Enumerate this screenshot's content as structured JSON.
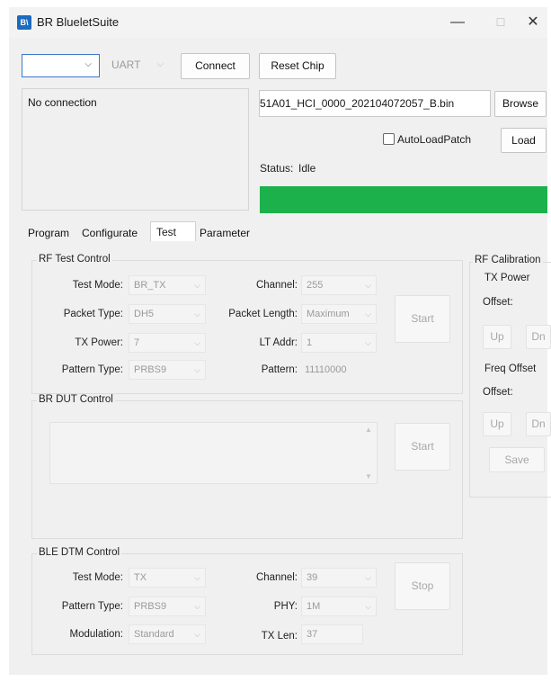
{
  "window": {
    "title": "BR BlueletSuite",
    "icon_text": "B\\",
    "minimize": "—",
    "maximize": "☐",
    "close": "✕"
  },
  "toolbar": {
    "port_value": "",
    "interface_value": "UART",
    "connect_label": "Connect",
    "reset_label": "Reset Chip"
  },
  "connection": {
    "status_text": "No connection"
  },
  "patch": {
    "file_name": "51A01_HCI_0000_202104072057_B.bin",
    "browse_label": "Browse",
    "autoload_label": "AutoLoadPatch",
    "autoload_checked": false,
    "load_label": "Load"
  },
  "status": {
    "label": "Status:",
    "value": "Idle",
    "bar_color": "#1cb14a",
    "progress": 1.0
  },
  "tabs": [
    {
      "label": "Program"
    },
    {
      "label": "Configurate"
    },
    {
      "label": "Test"
    },
    {
      "label": "Parameter"
    }
  ],
  "active_tab": "Test",
  "rf_test": {
    "title": "RF Test Control",
    "test_mode_label": "Test Mode:",
    "test_mode_value": "BR_TX",
    "channel_label": "Channel:",
    "channel_value": "255",
    "packet_type_label": "Packet Type:",
    "packet_type_value": "DH5",
    "packet_length_label": "Packet Length:",
    "packet_length_value": "Maximum",
    "tx_power_label": "TX Power:",
    "tx_power_value": "7",
    "lt_addr_label": "LT Addr:",
    "lt_addr_value": "1",
    "pattern_type_label": "Pattern Type:",
    "pattern_type_value": "PRBS9",
    "pattern_label": "Pattern:",
    "pattern_value": "11110000",
    "start_label": "Start"
  },
  "br_dut": {
    "title": "BR DUT Control",
    "start_label": "Start"
  },
  "ble_dtm": {
    "title": "BLE DTM Control",
    "test_mode_label": "Test Mode:",
    "test_mode_value": "TX",
    "channel_label": "Channel:",
    "channel_value": "39",
    "pattern_type_label": "Pattern Type:",
    "pattern_type_value": "PRBS9",
    "phy_label": "PHY:",
    "phy_value": "1M",
    "modulation_label": "Modulation:",
    "modulation_value": "Standard",
    "tx_len_label": "TX Len:",
    "tx_len_value": "37",
    "stop_label": "Stop"
  },
  "rf_calibration": {
    "title": "RF Calibration",
    "tx_power_title": "TX Power",
    "offset_label": "Offset:",
    "up_label": "Up",
    "dn_label": "Dn",
    "freq_offset_title": "Freq Offset",
    "freq_offset_label": "Offset:",
    "freq_up_label": "Up",
    "freq_dn_label": "Dn",
    "save_label": "Save"
  }
}
